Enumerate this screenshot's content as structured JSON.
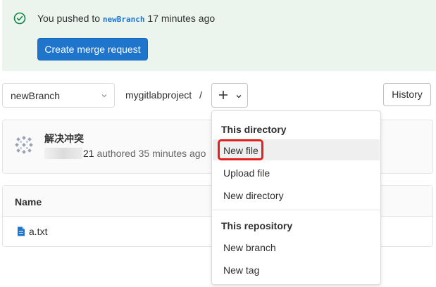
{
  "banner": {
    "prefix": "You pushed to",
    "branch": "newBranch",
    "suffix": "17 minutes ago",
    "button": "Create merge request"
  },
  "toolbar": {
    "branch": "newBranch",
    "project": "mygitlabproject",
    "separator": "/",
    "history": "History"
  },
  "commit": {
    "title": "解决冲突",
    "author_suffix": "21",
    "meta": "authored 35 minutes ago"
  },
  "table": {
    "header": "Name",
    "files": [
      {
        "name": "a.txt"
      }
    ]
  },
  "dropdown": {
    "section1": "This directory",
    "items1": [
      "New file",
      "Upload file",
      "New directory"
    ],
    "section2": "This repository",
    "items2": [
      "New branch",
      "New tag"
    ]
  },
  "colors": {
    "primary": "#1f75cb",
    "banner_bg": "#ecf4ee",
    "success": "#108548",
    "highlight_border": "#e3201b"
  },
  "icons": [
    "check-circle-icon",
    "chevron-down-icon",
    "plus-icon",
    "avatar-identicon",
    "file-icon"
  ]
}
